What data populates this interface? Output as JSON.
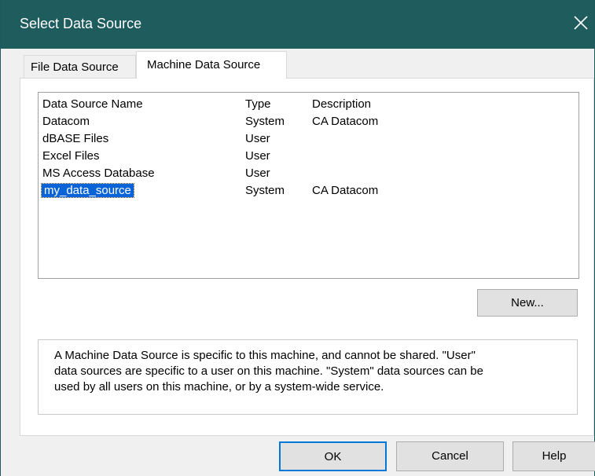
{
  "window": {
    "title": "Select Data Source",
    "close_icon": "close-icon"
  },
  "tabs": [
    {
      "label": "File Data Source",
      "active": false
    },
    {
      "label": "Machine Data Source",
      "active": true
    }
  ],
  "list": {
    "columns": [
      "Data Source Name",
      "Type",
      "Description"
    ],
    "rows": [
      {
        "name": "Datacom",
        "type": "System",
        "description": "CA Datacom"
      },
      {
        "name": "dBASE Files",
        "type": "User",
        "description": ""
      },
      {
        "name": "Excel Files",
        "type": "User",
        "description": ""
      },
      {
        "name": "MS Access Database",
        "type": "User",
        "description": ""
      },
      {
        "name": "my_data_source",
        "type": "System",
        "description": "CA Datacom"
      }
    ],
    "selected_index": 4,
    "selection_color": "#0a64d8"
  },
  "info": {
    "lines": [
      "A Machine Data Source is specific to this machine, and cannot be shared.  \"User\"",
      "data sources are specific to a user on this machine.  \"System\" data sources can be",
      "used by all users on this machine, or by a system-wide service."
    ]
  },
  "buttons": {
    "new": "New...",
    "ok": "OK",
    "cancel": "Cancel",
    "help": "Help"
  },
  "colors": {
    "titlebar": "#1f5c5e",
    "default_button_border": "#0078d7"
  }
}
